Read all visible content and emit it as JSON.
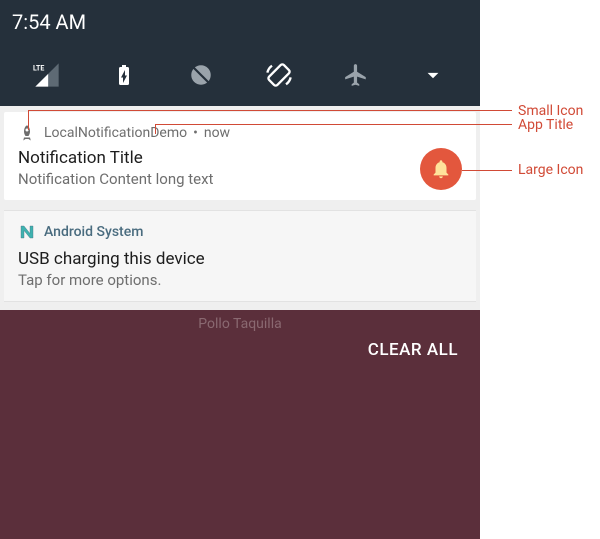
{
  "status": {
    "time": "7:54 AM"
  },
  "notification1": {
    "app_title": "LocalNotificationDemo",
    "timestamp": "now",
    "title": "Notification Title",
    "content": "Notification Content long text"
  },
  "notification2": {
    "app_title": "Android System",
    "title": "USB charging this device",
    "content": "Tap for more options."
  },
  "background": {
    "label": "Pollo Taquilla"
  },
  "actions": {
    "clear_all": "CLEAR ALL"
  },
  "annotations": {
    "small_icon": "Small Icon",
    "app_title": "App Title",
    "large_icon": "Large Icon"
  },
  "separator_dot": "•"
}
